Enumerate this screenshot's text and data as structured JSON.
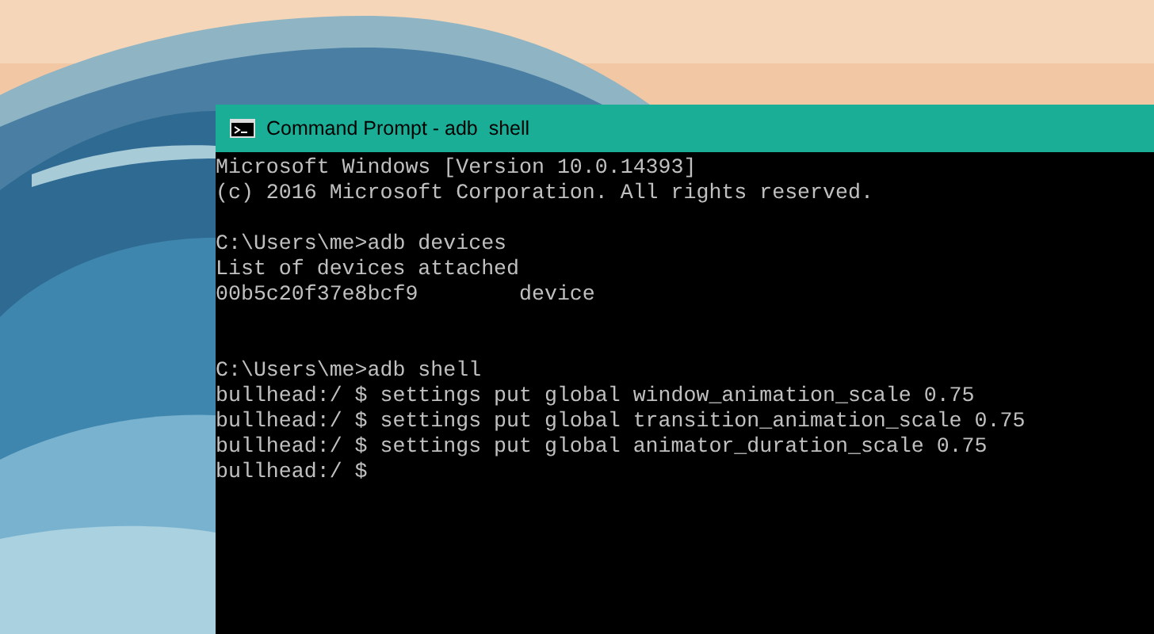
{
  "window": {
    "title": "Command Prompt - adb  shell"
  },
  "console": {
    "blocks": [
      {
        "blank_after": true,
        "extra_blank": false,
        "lines": [
          "Microsoft Windows [Version 10.0.14393]",
          "(c) 2016 Microsoft Corporation. All rights reserved."
        ]
      },
      {
        "blank_after": true,
        "extra_blank": true,
        "lines": [
          "C:\\Users\\me>adb devices",
          "List of devices attached",
          "00b5c20f37e8bcf9        device"
        ]
      },
      {
        "blank_after": false,
        "extra_blank": false,
        "lines": [
          "C:\\Users\\me>adb shell",
          "bullhead:/ $ settings put global window_animation_scale 0.75",
          "bullhead:/ $ settings put global transition_animation_scale 0.75",
          "bullhead:/ $ settings put global animator_duration_scale 0.75",
          "bullhead:/ $"
        ]
      }
    ]
  }
}
